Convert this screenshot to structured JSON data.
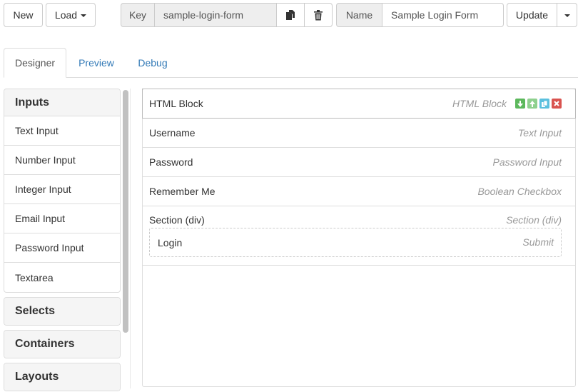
{
  "toolbar": {
    "new_label": "New",
    "load_label": "Load",
    "key_label": "Key",
    "key_value": "sample-login-form",
    "name_label": "Name",
    "name_value": "Sample Login Form",
    "update_label": "Update"
  },
  "tabs": [
    {
      "label": "Designer",
      "active": true
    },
    {
      "label": "Preview",
      "active": false
    },
    {
      "label": "Debug",
      "active": false
    }
  ],
  "sidebar": {
    "groups": [
      {
        "title": "Inputs",
        "items": [
          "Text Input",
          "Number Input",
          "Integer Input",
          "Email Input",
          "Password Input",
          "Textarea"
        ]
      },
      {
        "title": "Selects"
      },
      {
        "title": "Containers"
      },
      {
        "title": "Layouts"
      }
    ]
  },
  "form": {
    "rows": [
      {
        "label": "HTML Block",
        "type": "HTML Block"
      },
      {
        "label": "Username",
        "type": "Text Input"
      },
      {
        "label": "Password",
        "type": "Password Input"
      },
      {
        "label": "Remember Me",
        "type": "Boolean Checkbox"
      }
    ],
    "section": {
      "label": "Section (div)",
      "type": "Section (div)",
      "child": {
        "label": "Login",
        "type": "Submit"
      }
    }
  },
  "icons": {
    "copy": "copy-icon",
    "trash": "trash-icon",
    "move_down": "arrow-down-icon",
    "move_up": "arrow-up-icon",
    "duplicate": "duplicate-icon",
    "remove": "close-icon"
  },
  "colors": {
    "link": "#337ab7",
    "success": "#5cb85c",
    "info": "#5bc0de",
    "danger": "#d9534f"
  }
}
